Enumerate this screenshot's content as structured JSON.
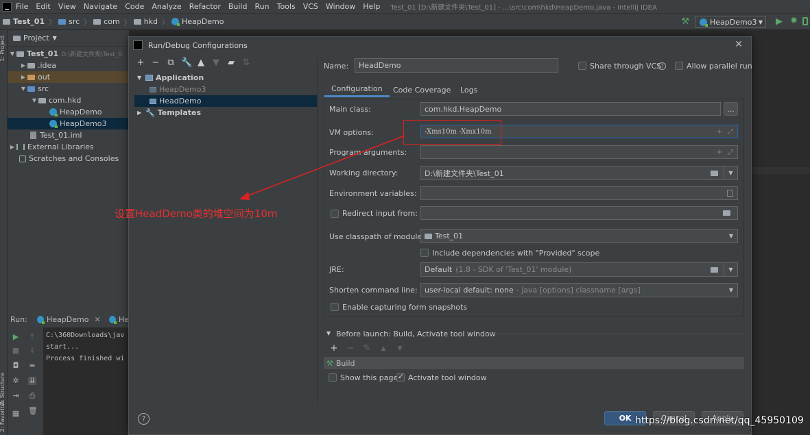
{
  "ide": {
    "menu": [
      "File",
      "Edit",
      "View",
      "Navigate",
      "Code",
      "Analyze",
      "Refactor",
      "Build",
      "Run",
      "Tools",
      "VCS",
      "Window",
      "Help"
    ],
    "title": "Test_01 [D:\\新建文件夹\\Test_01] - ...\\src\\com\\hkd\\HeapDemo.java - IntelliJ IDEA",
    "breadcrumb": [
      "Test_01",
      "src",
      "com",
      "hkd",
      "HeapDemo"
    ],
    "run_config": "HeapDemo3",
    "left_strip": [
      "1: Project",
      "Z: Structure",
      "2: Favorites"
    ]
  },
  "project_panel": {
    "header": "Project",
    "items": [
      {
        "label": "Test_01",
        "hint": "D:\\新建文件夹\\Test_0"
      },
      {
        "label": ".idea"
      },
      {
        "label": "out"
      },
      {
        "label": "src"
      },
      {
        "label": "com.hkd"
      },
      {
        "label": "HeapDemo"
      },
      {
        "label": "HeapDemo3"
      },
      {
        "label": "Test_01.iml"
      },
      {
        "label": "External Libraries"
      },
      {
        "label": "Scratches and Consoles"
      }
    ]
  },
  "run_panel": {
    "label": "Run:",
    "tab1": "HeapDemo",
    "tab2": "He",
    "console": [
      "C:\\360Downloads\\jav",
      "start...",
      "",
      "Process finished wi"
    ]
  },
  "dialog": {
    "title": "Run/Debug Configurations",
    "tree": {
      "application": "Application",
      "items": [
        "HeapDemo3",
        "HeadDemo"
      ],
      "templates": "Templates"
    },
    "name_label": "Name:",
    "name_value": "HeadDemo",
    "share_vcs": "Share through VCS",
    "allow_parallel": "Allow parallel run",
    "tabs": [
      "Configuration",
      "Code Coverage",
      "Logs"
    ],
    "fields": {
      "main_class_label": "Main class:",
      "main_class_value": "com.hkd.HeapDemo",
      "vm_options_label": "VM options:",
      "vm_options_value": "-Xms10m -Xmx10m",
      "program_args_label": "Program arguments:",
      "working_dir_label": "Working directory:",
      "working_dir_value": "D:\\新建文件夹\\Test_01",
      "env_vars_label": "Environment variables:",
      "redirect_label": "Redirect input from:",
      "classpath_label": "Use classpath of module:",
      "classpath_value": "Test_01",
      "include_deps": "Include dependencies with \"Provided\" scope",
      "jre_label": "JRE:",
      "jre_value": "Default",
      "jre_hint": "(1.8 - SDK of 'Test_01' module)",
      "shorten_label": "Shorten command line:",
      "shorten_value": "user-local default: none",
      "shorten_hint": "- java [options] classname [args]",
      "snapshots": "Enable capturing form snapshots"
    },
    "before_launch": "Before launch: Build, Activate tool window",
    "build_item": "Build",
    "show_page": "Show this page",
    "activate_tool": "Activate tool window",
    "buttons": {
      "ok": "OK",
      "cancel": "Cancel",
      "apply": "Apply"
    }
  },
  "annotation": "设置HeadDemo类的堆空间为10m",
  "watermark": "https://blog.csdn.net/qq_45950109",
  "colors": {
    "accent": "#4a88c7",
    "annotation": "#e02020",
    "ok_button": "#365880"
  }
}
